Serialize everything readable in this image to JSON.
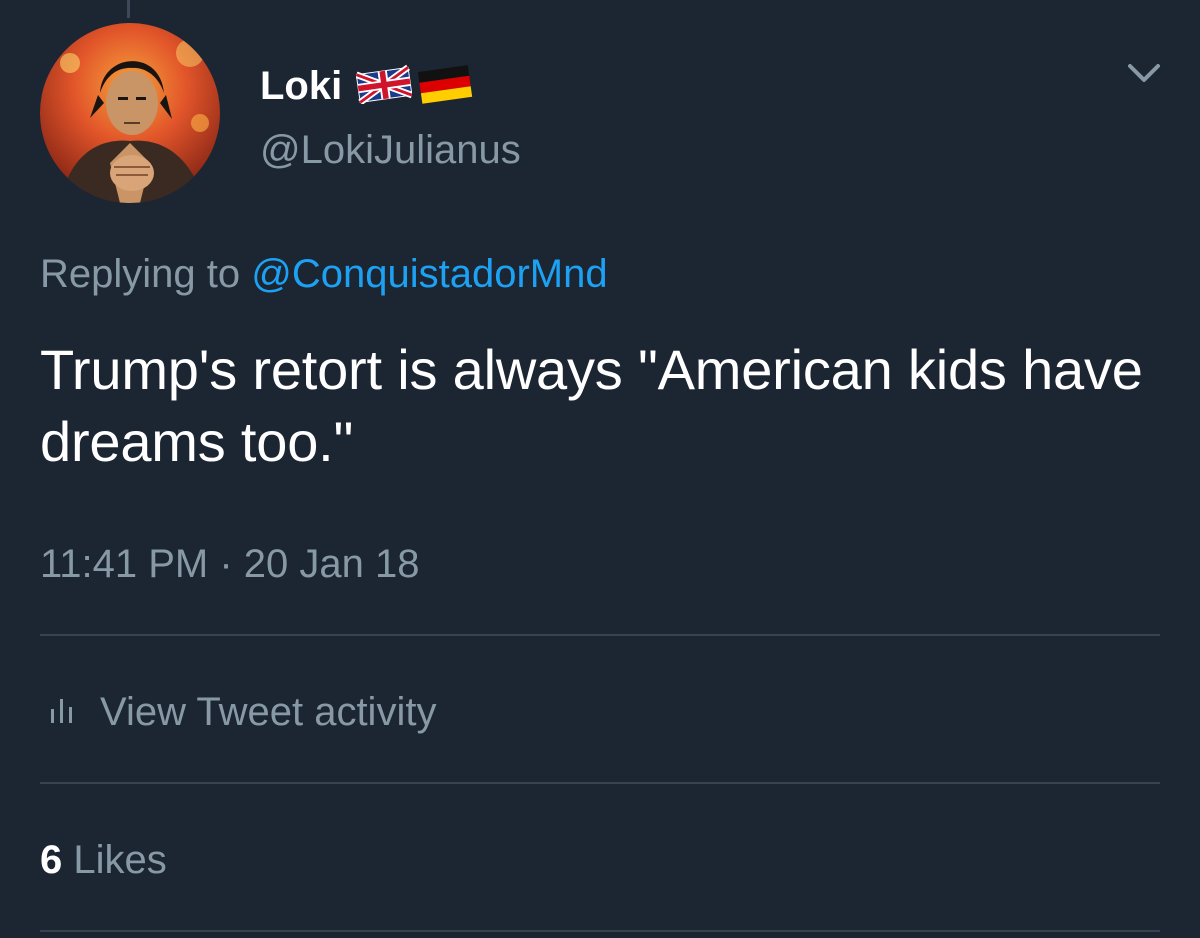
{
  "tweet": {
    "author": {
      "display_name": "Loki",
      "username": "@LokiJulianus",
      "flags": [
        "uk-flag-icon",
        "germany-flag-icon"
      ]
    },
    "replying_prefix": "Replying to",
    "replying_to": "@ConquistadorMnd",
    "text": "Trump's retort is always \"American kids have dreams too.\"",
    "timestamp": "11:41 PM · 20 Jan 18",
    "activity_label": "View Tweet activity",
    "likes_count": "6",
    "likes_label": "Likes"
  },
  "colors": {
    "background": "#1c2532",
    "primary_text": "#ffffff",
    "secondary_text": "#8899a6",
    "link": "#1da1f2",
    "divider": "#38444d"
  }
}
